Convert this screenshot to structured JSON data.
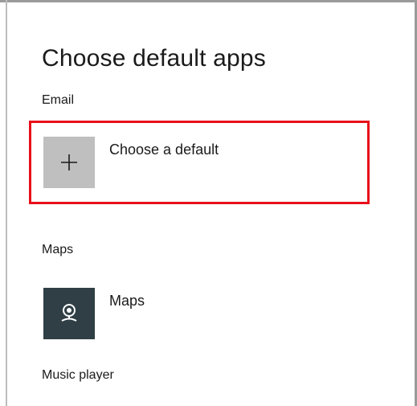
{
  "page": {
    "title": "Choose default apps"
  },
  "sections": {
    "email": {
      "label": "Email",
      "app": {
        "name": "Choose a default",
        "icon": "plus-icon"
      }
    },
    "maps": {
      "label": "Maps",
      "app": {
        "name": "Maps",
        "icon": "maps-app-icon"
      }
    },
    "music": {
      "label": "Music player"
    }
  },
  "colors": {
    "highlight": "#e8101a",
    "plus_tile": "#bfbfbf",
    "maps_tile": "#2f3f45"
  }
}
